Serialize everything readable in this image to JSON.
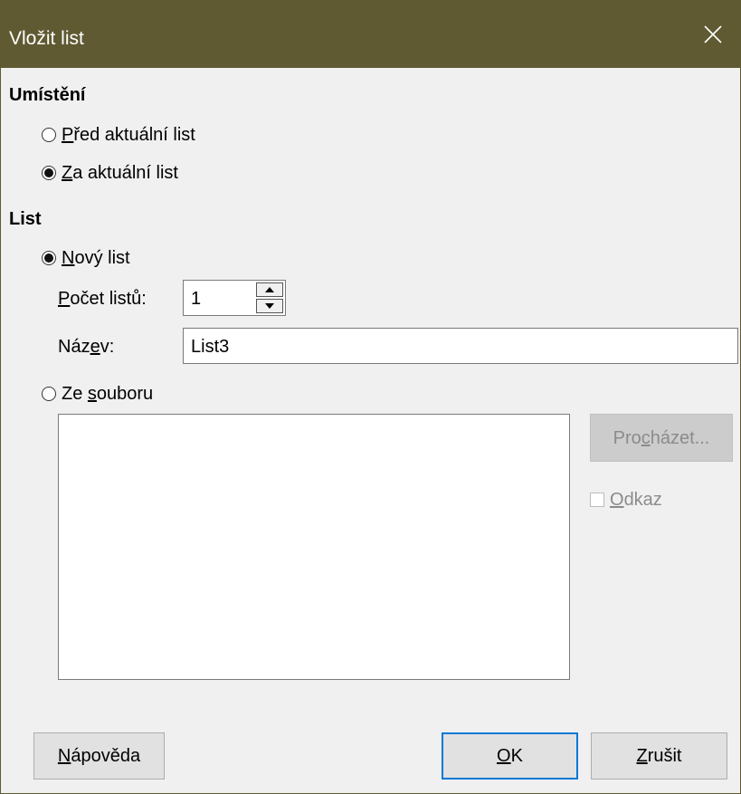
{
  "window": {
    "title": "Vložit list"
  },
  "placement": {
    "heading": "Umístění",
    "options": [
      {
        "label_prefix": "",
        "label_u": "P",
        "label_rest": "řed aktuální list",
        "checked": false
      },
      {
        "label_prefix": "",
        "label_u": "Z",
        "label_rest": "a aktuální list",
        "checked": true
      }
    ]
  },
  "sheet": {
    "heading": "List",
    "new_sheet": {
      "label_u": "N",
      "label_rest": "ový list",
      "checked": true
    },
    "count": {
      "label_u": "P",
      "label_rest": "očet listů:",
      "value": "1"
    },
    "name": {
      "label_pre": "Náz",
      "label_u": "e",
      "label_rest": "v:",
      "value": "List3"
    },
    "from_file": {
      "label_pre": "Ze ",
      "label_u": "s",
      "label_rest": "ouboru",
      "checked": false
    },
    "browse": {
      "label_pre": "Pro",
      "label_u": "c",
      "label_rest": "házet..."
    },
    "link": {
      "label_u": "O",
      "label_rest": "dkaz",
      "checked": false
    }
  },
  "buttons": {
    "help": {
      "label_u": "N",
      "label_rest": "ápověda"
    },
    "ok": {
      "label_u": "O",
      "label_rest": "K"
    },
    "cancel": {
      "label_u": "Z",
      "label_rest": "rušit"
    }
  }
}
